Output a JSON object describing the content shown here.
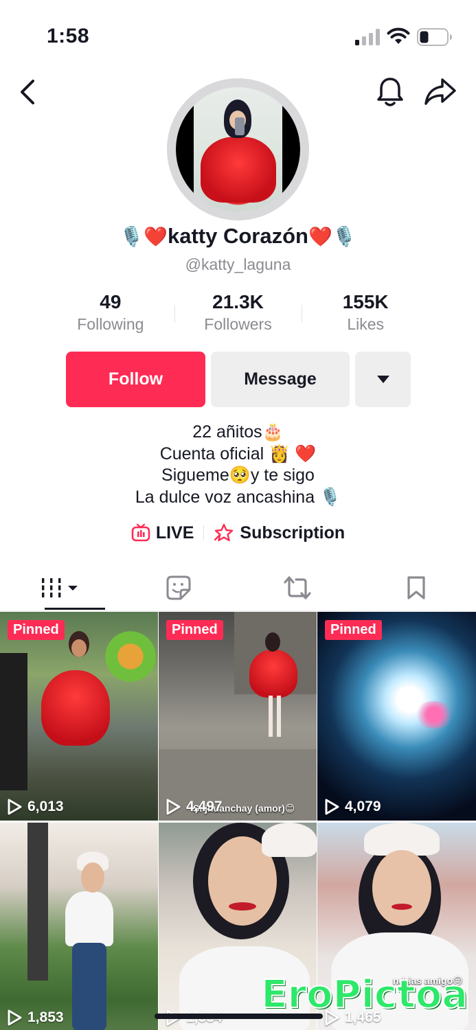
{
  "status_bar": {
    "time": "1:58"
  },
  "profile": {
    "display_name": "katty Corazón",
    "name_prefix_emoji": "🎙️❤️",
    "name_suffix_emoji": "❤️🎙️",
    "handle": "@katty_laguna",
    "avatar_icon": "profile-photo"
  },
  "stats": [
    {
      "value": "49",
      "label": "Following"
    },
    {
      "value": "21.3K",
      "label": "Followers"
    },
    {
      "value": "155K",
      "label": "Likes"
    }
  ],
  "actions": {
    "follow_label": "Follow",
    "message_label": "Message"
  },
  "bio": {
    "line1": "22 añitos🎂",
    "line2": "Cuenta oficial 👸 ❤️",
    "line3": "Sigueme🥺y te sigo",
    "line4": "La dulce voz ancashina 🎙️"
  },
  "links": {
    "live_label": "LIVE",
    "subscription_label": "Subscription"
  },
  "colors": {
    "accent": "#fe2c55",
    "text": "#161823",
    "muted": "#8a8b91",
    "button_grey": "#eeeeef"
  },
  "tabs": [
    "videos-grid-icon",
    "favorites-icon",
    "reposts-icon",
    "saved-icon"
  ],
  "videos": [
    {
      "pinned": "Pinned",
      "views": "6,013"
    },
    {
      "pinned": "Pinned",
      "views": "4,497",
      "overlay": "Si jhuanchay (amor)😊"
    },
    {
      "pinned": "Pinned",
      "views": "4,079"
    },
    {
      "views": "1,853"
    },
    {
      "views": "1,884"
    },
    {
      "views": "1,465",
      "overlay": "ndrias amigo😔"
    }
  ],
  "watermark": "EroPictoa"
}
